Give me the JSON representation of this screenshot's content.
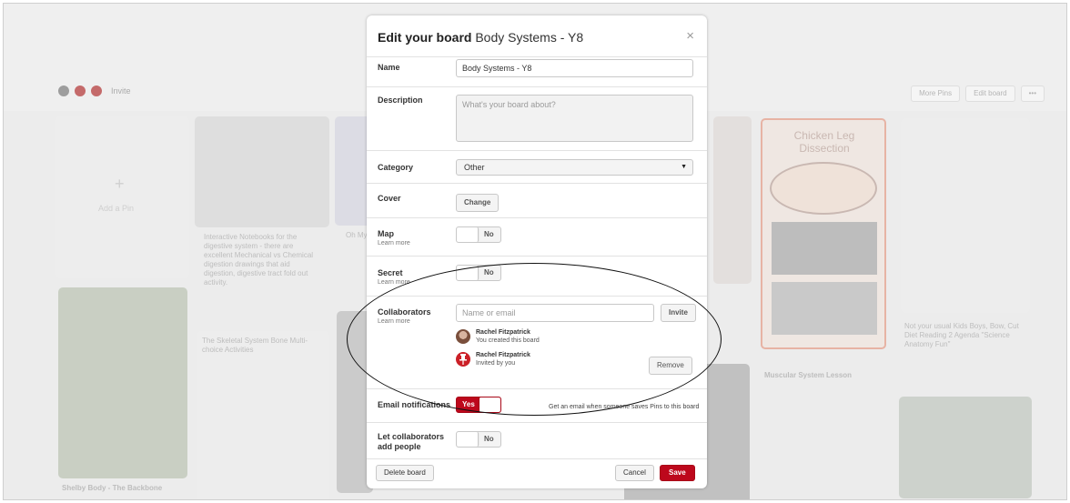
{
  "background": {
    "invite_label": "Invite",
    "buttons": [
      "More Pins",
      "Edit board",
      "•••"
    ],
    "add_pin_label": "Add a Pin",
    "pin_texts": [
      "Interactive Notebooks for the digestive system - there are excellent Mechanical vs Chemical digestion drawings that aid digestion, digestive tract fold out activity.",
      "Oh My",
      "Chicken Leg Dissection",
      "Muscular System Lesson",
      "Not your usual Kids Boys, Bow, Cut Diet Reading 2 Agenda \"Science Anatomy Fun\"",
      "Shelby Body - The Backbone",
      "The Skeletal System Bone Multi-choice Activities"
    ]
  },
  "dialog": {
    "title_bold": "Edit your board",
    "title_rest": "Body Systems - Y8",
    "close_glyph": "×",
    "name": {
      "label": "Name",
      "value": "Body Systems - Y8"
    },
    "description": {
      "label": "Description",
      "placeholder": "What's your board about?"
    },
    "category": {
      "label": "Category",
      "selected": "Other",
      "caret": "▼"
    },
    "cover": {
      "label": "Cover",
      "button": "Change"
    },
    "map": {
      "label": "Map",
      "sub": "Learn more",
      "state": "No"
    },
    "secret": {
      "label": "Secret",
      "sub": "Learn more",
      "state": "No"
    },
    "collaborators": {
      "label": "Collaborators",
      "sub": "Learn more",
      "placeholder": "Name or email",
      "invite_button": "Invite",
      "people": [
        {
          "name": "Rachel Fitzpatrick",
          "note": "You created this board"
        },
        {
          "name": "Rachel Fitzpatrick",
          "note": "Invited by you"
        }
      ],
      "remove_button": "Remove"
    },
    "email_notifications": {
      "label": "Email notifications",
      "state": "Yes",
      "note": "Get an email when someone saves Pins to this board"
    },
    "let_collaborators": {
      "label_line1": "Let collaborators",
      "label_line2": "add people",
      "state": "No"
    },
    "footer": {
      "delete": "Delete board",
      "cancel": "Cancel",
      "save": "Save"
    }
  },
  "colors": {
    "accent": "#bd081c",
    "border": "#e2e2e2"
  }
}
